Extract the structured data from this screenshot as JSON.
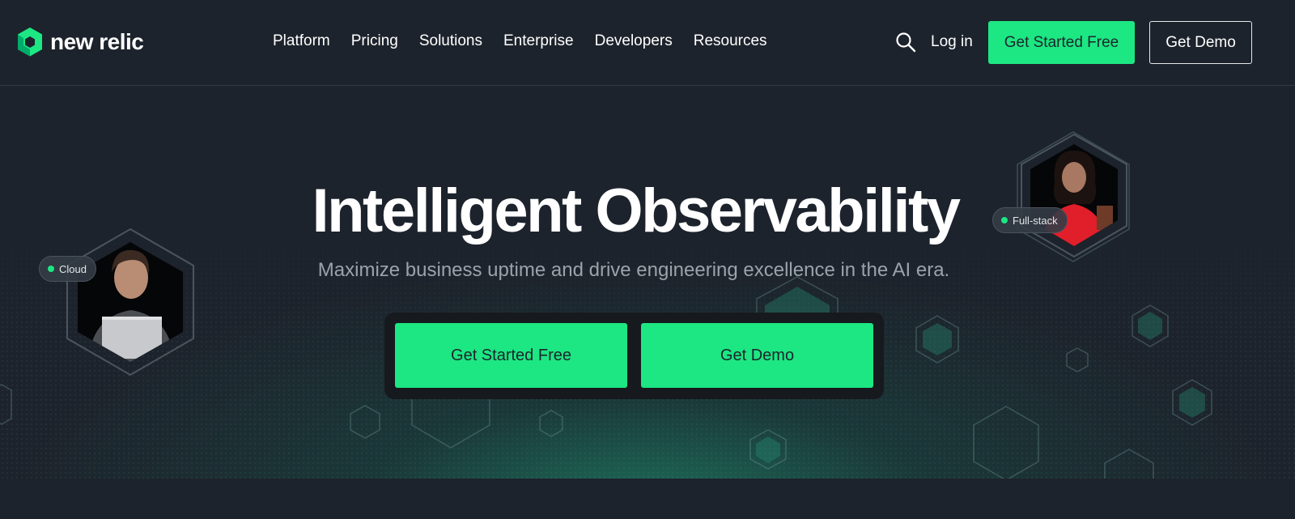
{
  "brand": {
    "name": "new relic",
    "accent": "#1ce783",
    "background": "#1d232c"
  },
  "header": {
    "logo_text": "new relic",
    "nav": [
      {
        "label": "Platform"
      },
      {
        "label": "Pricing"
      },
      {
        "label": "Solutions"
      },
      {
        "label": "Enterprise"
      },
      {
        "label": "Developers"
      },
      {
        "label": "Resources"
      }
    ],
    "search_icon": "search-icon",
    "login_label": "Log in",
    "get_started_label": "Get Started Free",
    "get_demo_label": "Get Demo"
  },
  "hero": {
    "title": "Intelligent Observability",
    "subtitle": "Maximize business uptime and drive engineering excellence in the AI era.",
    "cta_primary": "Get Started Free",
    "cta_secondary": "Get Demo",
    "badges": {
      "left": "Cloud",
      "right": "Full-stack"
    }
  }
}
